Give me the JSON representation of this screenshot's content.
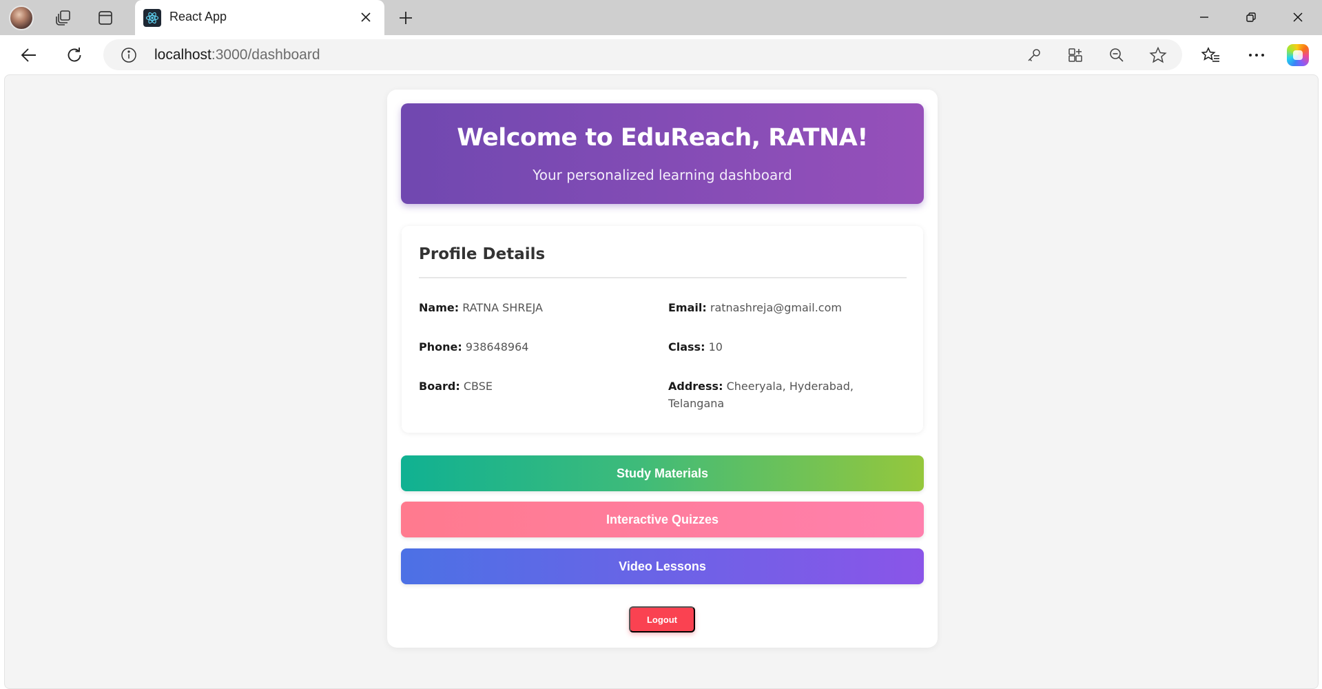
{
  "browser": {
    "tab_title": "React App",
    "url_host": "localhost",
    "url_path": ":3000/dashboard"
  },
  "icons": {
    "profile": "avatar",
    "workspaces": "workspaces-icon",
    "tab_actions": "tab-actions-icon",
    "favicon": "react-icon",
    "close": "close-icon",
    "new_tab": "plus-icon",
    "back": "back-arrow-icon",
    "reload": "reload-icon",
    "info": "info-icon",
    "key": "key-icon",
    "apps": "apps-icon",
    "zoom": "zoom-out-icon",
    "favorite": "star-icon",
    "favorites": "favorites-icon",
    "more": "more-icon",
    "copilot": "copilot-icon"
  },
  "dashboard": {
    "welcome_title": "Welcome to EduReach, RATNA!",
    "welcome_subtitle": "Your personalized learning dashboard",
    "profile": {
      "heading": "Profile Details",
      "fields": [
        {
          "label": "Name:",
          "value": "RATNA SHREJA"
        },
        {
          "label": "Email:",
          "value": "ratnashreja@gmail.com"
        },
        {
          "label": "Phone:",
          "value": "938648964"
        },
        {
          "label": "Class:",
          "value": "10"
        },
        {
          "label": "Board:",
          "value": "CBSE"
        },
        {
          "label": "Address:",
          "value": "Cheeryala, Hyderabad, Telangana"
        }
      ]
    },
    "actions": [
      {
        "label": "Study Materials"
      },
      {
        "label": "Interactive Quizzes"
      },
      {
        "label": "Video Lessons"
      }
    ],
    "logout_label": "Logout"
  },
  "colors": {
    "hero_start": "#7048b0",
    "hero_end": "#9650ba",
    "study_start": "#10b192",
    "study_end": "#95c73c",
    "quiz_start": "#ff7a8e",
    "quiz_end": "#ff80ad",
    "video_start": "#4c71e5",
    "video_end": "#8a55e8",
    "logout": "#fa4251"
  }
}
